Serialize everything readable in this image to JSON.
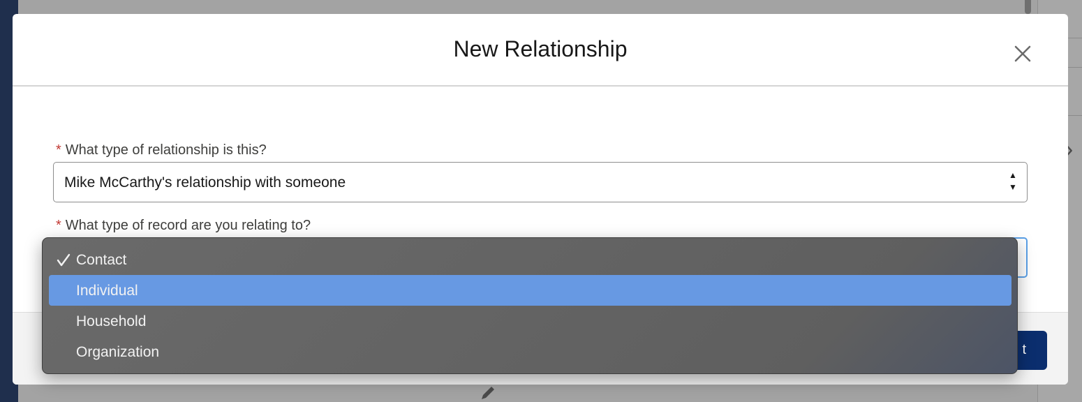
{
  "modal": {
    "title": "New Relationship",
    "close_icon": "close-icon",
    "next_button_label": "t"
  },
  "form": {
    "relationship_type": {
      "label": "What type of relationship is this?",
      "required_marker": "*",
      "value": "Mike McCarthy's relationship with someone"
    },
    "record_type": {
      "label": "What type of record are you relating to?",
      "required_marker": "*",
      "options": [
        {
          "label": "Contact",
          "checked": true
        },
        {
          "label": "Individual",
          "highlighted": true
        },
        {
          "label": "Household"
        },
        {
          "label": "Organization"
        }
      ]
    }
  },
  "colors": {
    "highlight": "#6799e3",
    "required": "#c23934",
    "primary_button": "#0b2e6e",
    "focus_border": "#5aa0e8"
  }
}
